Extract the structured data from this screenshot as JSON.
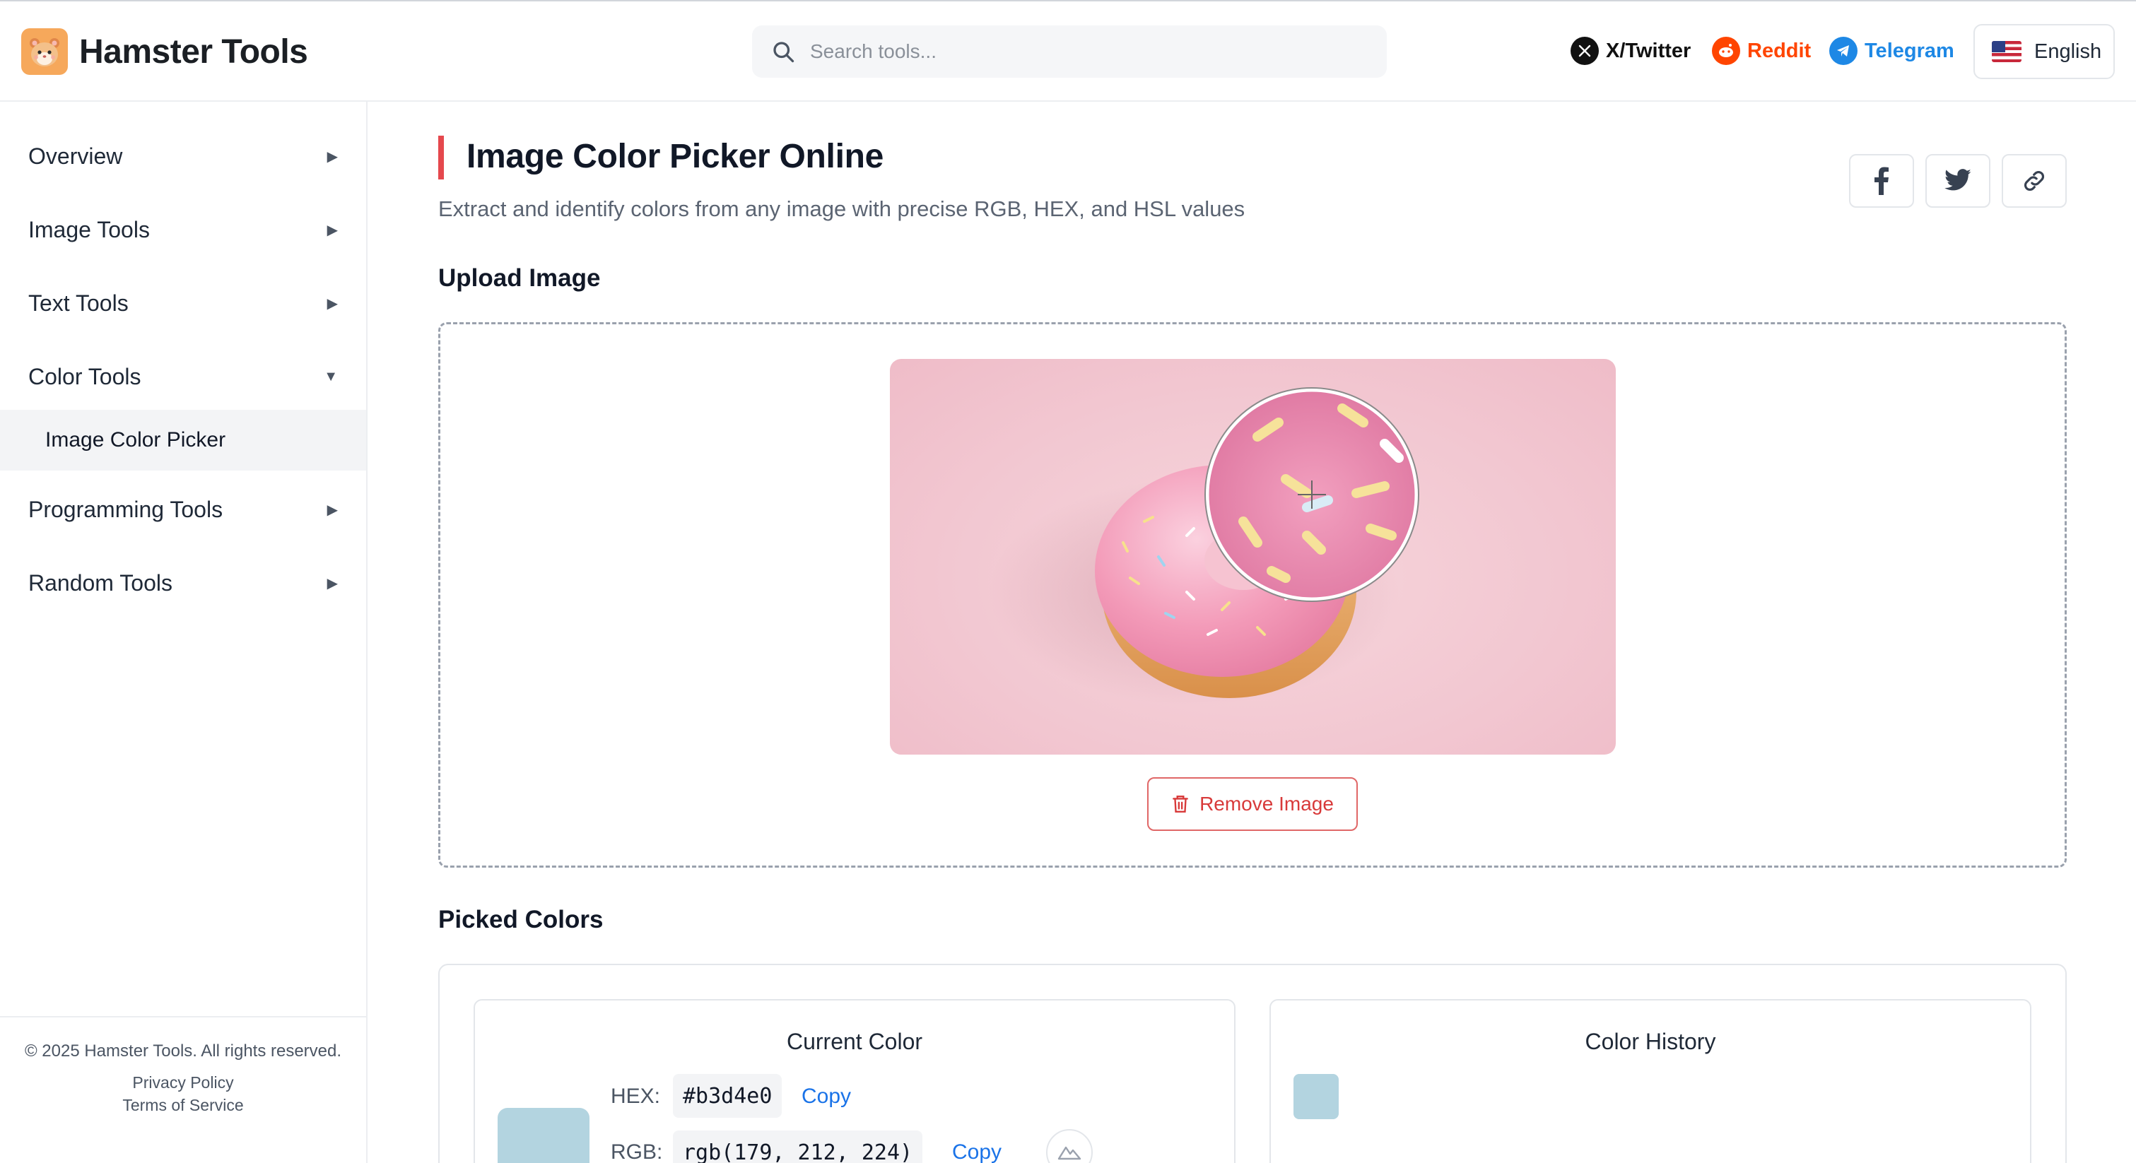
{
  "header": {
    "brand": "Hamster Tools",
    "search_placeholder": "Search tools...",
    "social": [
      {
        "label": "X/Twitter",
        "color": "#111111"
      },
      {
        "label": "Reddit",
        "color": "#ff4500"
      },
      {
        "label": "Telegram",
        "color": "#1e88e5"
      }
    ],
    "language": "English"
  },
  "sidebar": {
    "items": [
      {
        "label": "Overview",
        "arrow": "▶"
      },
      {
        "label": "Image Tools",
        "arrow": "▶"
      },
      {
        "label": "Text Tools",
        "arrow": "▶"
      },
      {
        "label": "Color Tools",
        "arrow": "▼"
      },
      {
        "label": "Programming Tools",
        "arrow": "▶"
      },
      {
        "label": "Random Tools",
        "arrow": "▶"
      }
    ],
    "active_sub": "Image Color Picker",
    "footer": {
      "copyright": "© 2025 Hamster Tools. All rights reserved.",
      "privacy": "Privacy Policy",
      "terms": "Terms of Service"
    }
  },
  "main": {
    "title": "Image Color Picker Online",
    "subtitle": "Extract and identify colors from any image with precise RGB, HEX, and HSL values",
    "upload_title": "Upload Image",
    "remove_label": "Remove Image",
    "picked_title": "Picked Colors",
    "current": {
      "title": "Current Color",
      "hex_label": "HEX:",
      "hex_value": "#b3d4e0",
      "rgb_label": "RGB:",
      "rgb_value": "rgb(179, 212, 224)",
      "copy_label": "Copy",
      "swatch_color": "#b3d4e0"
    },
    "history": {
      "title": "Color History",
      "swatches": [
        "#b3d4e0"
      ]
    }
  },
  "colors": {
    "accent": "#e5484d",
    "link": "#1a73e8",
    "danger": "#d83a3a"
  }
}
